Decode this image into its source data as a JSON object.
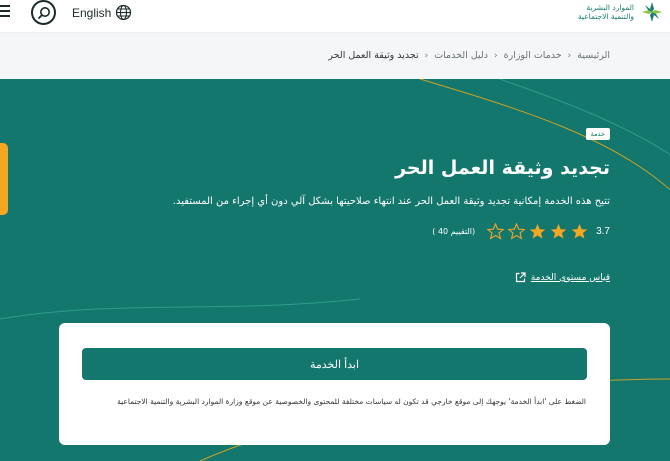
{
  "header": {
    "language_label": "English",
    "logo_line1": "الموارد البشرية",
    "logo_line2": "والتنمية الاجتماعية"
  },
  "breadcrumb": {
    "items": [
      "الرئيسية",
      "خدمات الوزارة",
      "دليل الخدمات",
      "تجديد وثيقة العمل الحر"
    ]
  },
  "service": {
    "badge": "خدمة",
    "title": "تجديد وثيقة العمل الحر",
    "description": "تتيح هذه الخدمة إمكانية تجديد وثيقة العمل الحر عند انتهاء صلاحيتها بشكل آلي دون أي إجراء من المستفيد.",
    "rating_value": "3.7",
    "rating_count": "(التقييم 40 )",
    "stars_filled": 3,
    "stars_total": 5,
    "satisfaction_link": "قياس مستوى الخدمة"
  },
  "card": {
    "start_button": "ابدأ الخدمة",
    "notice": "الضغط على 'ابدأ الخدمة' يوجهك إلى موقع خارجي قد تكون له سياسات مختلفة للمحتوى والخصوصية عن موقع وزارة الموارد البشرية والتنمية الاجتماعية"
  },
  "colors": {
    "primary": "#13776d",
    "accent": "#f5a623",
    "star_filled": "#f5a623"
  }
}
